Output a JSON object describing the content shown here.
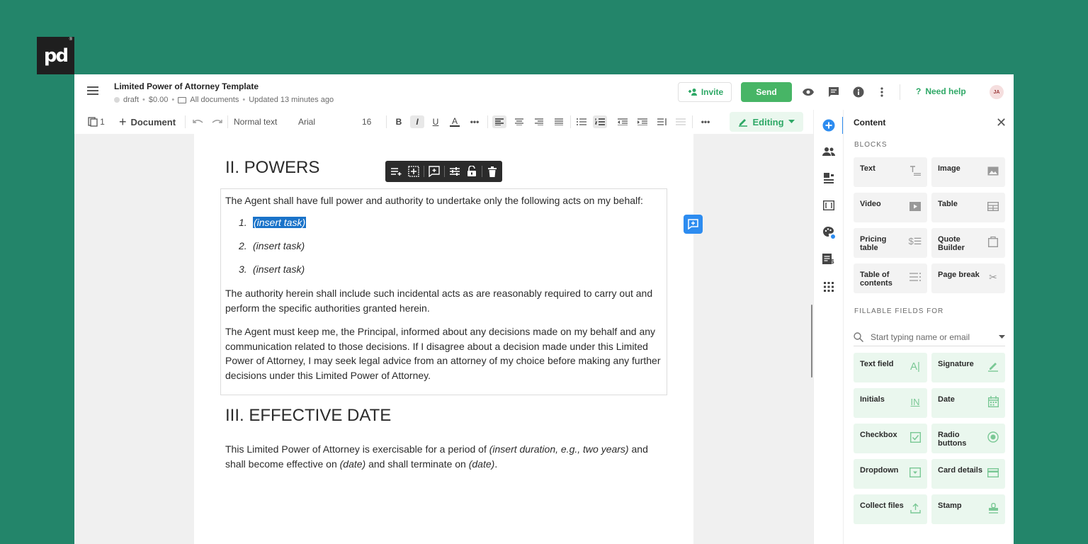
{
  "brand": {
    "logo_text": "pd",
    "registered": "®"
  },
  "header": {
    "title": "Limited Power of Attorney Template",
    "status": "draft",
    "price": "$0.00",
    "folder": "All documents",
    "updated": "Updated 13 minutes ago",
    "invite_label": "Invite",
    "send_label": "Send",
    "help_label": "Need help",
    "avatar_initials": "JA"
  },
  "toolbar": {
    "page_count": "1",
    "add_label": "Document",
    "style_select": "Normal text",
    "font_select": "Arial",
    "size_select": "16",
    "editing_label": "Editing"
  },
  "document": {
    "section2_heading": "II. POWERS",
    "intro": "The Agent shall have full power and authority to undertake only the following acts on my behalf:",
    "list": [
      {
        "num": "1.",
        "text": "(insert task)"
      },
      {
        "num": "2.",
        "text": "(insert task)"
      },
      {
        "num": "3.",
        "text": "(insert task)"
      }
    ],
    "para_incidental": "The authority herein shall include such incidental acts as are reasonably required to carry out and perform the specific authorities granted herein.",
    "para_inform": "The Agent must keep me, the Principal, informed about any decisions made on my behalf and any communication related to those decisions. If I disagree about a decision made under this Limited Power of Attorney, I may seek legal advice from an attorney of my choice before making any further decisions under this Limited Power of Attorney.",
    "section3_heading": "III. EFFECTIVE DATE",
    "effective_pre": "This Limited Power of Attorney is exercisable for a period of ",
    "effective_duration": "(insert duration, e.g., two years)",
    "effective_mid": " and shall become effective on ",
    "effective_date1": "(date)",
    "effective_mid2": " and shall terminate on ",
    "effective_date2": "(date)",
    "effective_end": "."
  },
  "panel": {
    "title": "Content",
    "blocks_label": "BLOCKS",
    "blocks": [
      {
        "label": "Text",
        "icon": "text-block-icon"
      },
      {
        "label": "Image",
        "icon": "image-block-icon"
      },
      {
        "label": "Video",
        "icon": "video-block-icon"
      },
      {
        "label": "Table",
        "icon": "table-block-icon"
      },
      {
        "label": "Pricing table",
        "icon": "pricing-table-icon"
      },
      {
        "label": "Quote Builder",
        "icon": "quote-builder-icon"
      },
      {
        "label": "Table of contents",
        "icon": "toc-icon"
      },
      {
        "label": "Page break",
        "icon": "scissors-icon"
      }
    ],
    "fields_label": "FILLABLE FIELDS FOR",
    "search_placeholder": "Start typing name or email",
    "fields": [
      {
        "label": "Text field",
        "icon": "text-field-icon"
      },
      {
        "label": "Signature",
        "icon": "signature-pen-icon"
      },
      {
        "label": "Initials",
        "icon": "initials-icon"
      },
      {
        "label": "Date",
        "icon": "calendar-icon"
      },
      {
        "label": "Checkbox",
        "icon": "checkbox-icon"
      },
      {
        "label": "Radio buttons",
        "icon": "radio-icon"
      },
      {
        "label": "Dropdown",
        "icon": "dropdown-icon"
      },
      {
        "label": "Card details",
        "icon": "card-icon"
      },
      {
        "label": "Collect files",
        "icon": "upload-icon"
      },
      {
        "label": "Stamp",
        "icon": "stamp-icon"
      }
    ]
  },
  "colors": {
    "background": "#23856a",
    "accent_green": "#47b566",
    "accent_blue": "#2d8cf0",
    "selection": "#1a73c9"
  }
}
